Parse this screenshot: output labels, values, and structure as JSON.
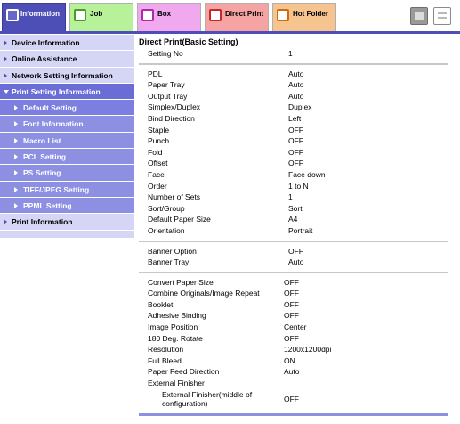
{
  "tabs": [
    {
      "label": "Information"
    },
    {
      "label": "Job"
    },
    {
      "label": "Box"
    },
    {
      "label": "Direct Print"
    },
    {
      "label": "Hot Folder"
    }
  ],
  "sidebar": {
    "items": [
      {
        "label": "Device Information"
      },
      {
        "label": "Online Assistance"
      },
      {
        "label": "Network Setting Information"
      },
      {
        "label": "Print Setting Information"
      },
      {
        "label": "Default Setting"
      },
      {
        "label": "Font Information"
      },
      {
        "label": "Macro List"
      },
      {
        "label": "PCL Setting"
      },
      {
        "label": "PS Setting"
      },
      {
        "label": "TIFF/JPEG Setting"
      },
      {
        "label": "PPML Setting"
      },
      {
        "label": "Print Information"
      }
    ]
  },
  "main": {
    "title": "Direct Print(Basic Setting)",
    "setting_no": {
      "label": "Setting No",
      "value": "1"
    },
    "group1": [
      {
        "label": "PDL",
        "value": "Auto"
      },
      {
        "label": "Paper Tray",
        "value": "Auto"
      },
      {
        "label": "Output Tray",
        "value": "Auto"
      },
      {
        "label": "Simplex/Duplex",
        "value": "Duplex"
      },
      {
        "label": "Bind Direction",
        "value": "Left"
      },
      {
        "label": "Staple",
        "value": "OFF"
      },
      {
        "label": "Punch",
        "value": "OFF"
      },
      {
        "label": "Fold",
        "value": "OFF"
      },
      {
        "label": "Offset",
        "value": "OFF"
      },
      {
        "label": "Face",
        "value": "Face down"
      },
      {
        "label": "Order",
        "value": "1 to N"
      },
      {
        "label": "Number of Sets",
        "value": "1"
      },
      {
        "label": "Sort/Group",
        "value": "Sort"
      },
      {
        "label": "Default Paper Size",
        "value": "A4"
      },
      {
        "label": "Orientation",
        "value": "Portrait"
      }
    ],
    "group2": [
      {
        "label": "Banner Option",
        "value": "OFF"
      },
      {
        "label": "Banner Tray",
        "value": "Auto"
      }
    ],
    "group3": [
      {
        "label": "Convert Paper Size",
        "value": "OFF"
      },
      {
        "label": "Combine Originals/Image Repeat",
        "value": "OFF"
      },
      {
        "label": "Booklet",
        "value": "OFF"
      },
      {
        "label": "Adhesive Binding",
        "value": "OFF"
      },
      {
        "label": "Image Position",
        "value": "Center"
      },
      {
        "label": "180 Deg. Rotate",
        "value": "OFF"
      },
      {
        "label": "Resolution",
        "value": "1200x1200dpi"
      },
      {
        "label": "Full Bleed",
        "value": "ON"
      },
      {
        "label": "Paper Feed Direction",
        "value": "Auto"
      },
      {
        "label": "External Finisher",
        "value": ""
      }
    ],
    "sub_item": {
      "label": "External Finisher(middle of configuration)",
      "value": "OFF"
    }
  },
  "colors": {
    "accent": "#4e4fb6",
    "sidebar_bg": "#d5d6f5",
    "sidebar_active": "#6b6dd6"
  },
  "icons": [
    "information-icon",
    "job-icon",
    "box-icon",
    "direct-print-icon",
    "hot-folder-icon",
    "settings-icon",
    "list-icon"
  ]
}
